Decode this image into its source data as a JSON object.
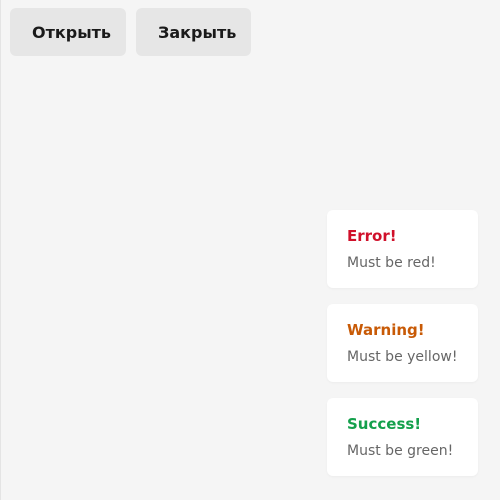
{
  "toolbar": {
    "open_label": "Открыть",
    "close_label": "Закрыть"
  },
  "toasts": [
    {
      "title": "Error!",
      "message": "Must be red!",
      "color": "#d0102a"
    },
    {
      "title": "Warning!",
      "message": "Must be yellow!",
      "color": "#c85a06"
    },
    {
      "title": "Success!",
      "message": "Must be green!",
      "color": "#14a04c"
    }
  ]
}
